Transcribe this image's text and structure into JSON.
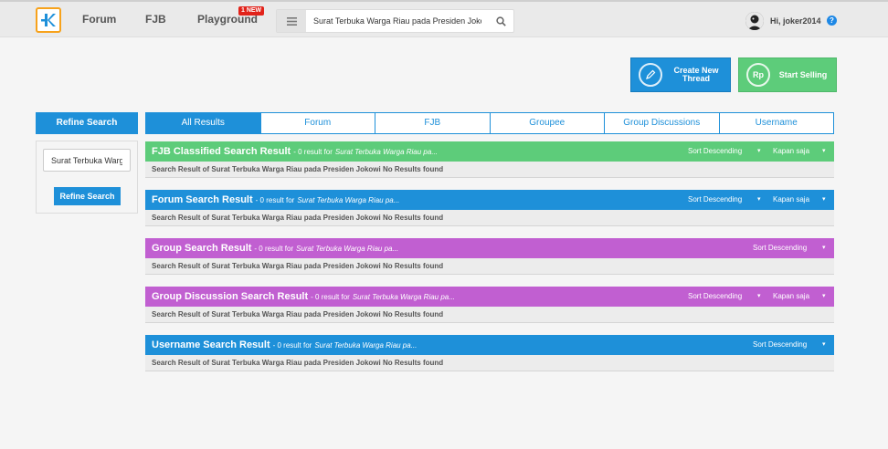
{
  "nav": {
    "forum": "Forum",
    "fjb": "FJB",
    "playground": "Playground",
    "new_badge": "1 NEW"
  },
  "search": {
    "value": "Surat Terbuka Warga Riau pada Presiden Jokowi",
    "icon": "search-icon"
  },
  "user": {
    "greeting": "Hi, joker2014",
    "help": "?"
  },
  "actions": {
    "create_label_1": "Create New",
    "create_label_2": "Thread",
    "sell_label": "Start Selling",
    "sell_icon_text": "Rp"
  },
  "sidebar": {
    "heading": "Refine Search",
    "input_value": "Surat Terbuka Warga Riau pada Presiden Jokowi",
    "button": "Refine Search"
  },
  "tabs": [
    {
      "label": "All Results"
    },
    {
      "label": "Forum"
    },
    {
      "label": "FJB"
    },
    {
      "label": "Groupee"
    },
    {
      "label": "Group Discussions"
    },
    {
      "label": "Username"
    }
  ],
  "sections": [
    {
      "title": "FJB Classified Search Result",
      "count": "- 0 result for",
      "query": "Surat Terbuka Warga Riau pa...",
      "sort": "Sort Descending",
      "time": "Kapan saja",
      "body": "Search Result of Surat Terbuka Warga Riau pada Presiden Jokowi No Results found",
      "color": "#5dcc7a"
    },
    {
      "title": "Forum Search Result",
      "count": "- 0 result for",
      "query": "Surat Terbuka Warga Riau pa...",
      "sort": "Sort Descending",
      "time": "Kapan saja",
      "body": "Search Result of Surat Terbuka Warga Riau pada Presiden Jokowi No Results found",
      "color": "#1e90d9"
    },
    {
      "title": "Group Search Result",
      "count": "- 0 result for",
      "query": "Surat Terbuka Warga Riau pa...",
      "sort": "Sort Descending",
      "body": "Search Result of Surat Terbuka Warga Riau pada Presiden Jokowi No Results found",
      "color": "#c15fd1"
    },
    {
      "title": "Group Discussion Search Result",
      "count": "- 0 result for",
      "query": "Surat Terbuka Warga Riau pa...",
      "sort": "Sort Descending",
      "time": "Kapan saja",
      "body": "Search Result of Surat Terbuka Warga Riau pada Presiden Jokowi No Results found",
      "color": "#c15fd1"
    },
    {
      "title": "Username Search Result",
      "count": "- 0 result for",
      "query": "Surat Terbuka Warga Riau pa...",
      "sort": "Sort Descending",
      "body": "Search Result of Surat Terbuka Warga Riau pada Presiden Jokowi No Results found",
      "color": "#1e90d9"
    }
  ]
}
